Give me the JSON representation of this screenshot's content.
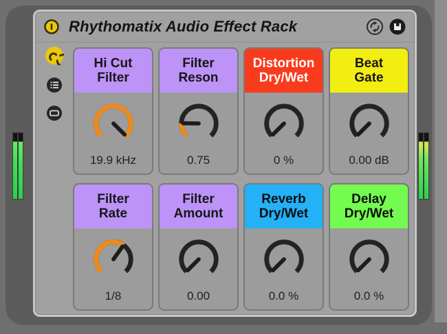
{
  "theme": {
    "page_bg": "#6f6f6f",
    "panel_bg": "#5c5c5c",
    "rack_bg": "#a1a1a1",
    "rack_border": "#c9c9c9",
    "tile_bg": "#9c9c9c",
    "tile_border": "#7a7a7a",
    "knob_ring": "#232323",
    "knob_active": "#ef8a1b",
    "knob_pointer": "#1d1d1d",
    "meter_cap": "#141414",
    "meter_green": "#2bd04e",
    "meter_yellow": "#c9e955",
    "accent_yellow": "#edc70c",
    "header_purple": "#bd93f7",
    "header_red": "#f93b1d",
    "header_yellow": "#f2ee12",
    "header_blue": "#24b1f6",
    "header_green": "#73fb50"
  },
  "title_bar": {
    "title": "Rhythomatix Audio Effect Rack",
    "icons": {
      "power": "device-activator-icon",
      "hot_swap": "hot-swap-icon",
      "save": "save-preset-icon"
    }
  },
  "sidebar": {
    "buttons": [
      {
        "id": "show-macros",
        "icon": "macro-spiral-icon"
      },
      {
        "id": "show-chain-list",
        "icon": "chain-list-icon"
      },
      {
        "id": "show-devices",
        "icon": "devices-icon"
      }
    ]
  },
  "meters": {
    "left_channels": 2,
    "right_channels": 2
  },
  "macros": [
    {
      "id": "hi-cut-filter",
      "label": [
        "Hi Cut",
        "Filter"
      ],
      "value": "19.9 kHz",
      "header_color": "#bd93f7",
      "label_color": "#161616",
      "knob_fraction": 1.0
    },
    {
      "id": "filter-reson",
      "label": [
        "Filter",
        "Reson"
      ],
      "value": "0.75",
      "header_color": "#bd93f7",
      "label_color": "#161616",
      "knob_fraction": 0.17
    },
    {
      "id": "distortion-dry-wet",
      "label": [
        "Distortion",
        "Dry/Wet"
      ],
      "value": "0 %",
      "header_color": "#f93b1d",
      "label_color": "#ffffff",
      "knob_fraction": 0.0
    },
    {
      "id": "beat-gate",
      "label": [
        "Beat",
        "Gate"
      ],
      "value": "0.00 dB",
      "header_color": "#f2ee12",
      "label_color": "#161616",
      "knob_fraction": 0.0
    },
    {
      "id": "filter-rate",
      "label": [
        "Filter",
        "Rate"
      ],
      "value": "1/8",
      "header_color": "#bd93f7",
      "label_color": "#161616",
      "knob_fraction": 0.63
    },
    {
      "id": "filter-amount",
      "label": [
        "Filter",
        "Amount"
      ],
      "value": "0.00",
      "header_color": "#bd93f7",
      "label_color": "#161616",
      "knob_fraction": 0.0
    },
    {
      "id": "reverb-dry-wet",
      "label": [
        "Reverb",
        "Dry/Wet"
      ],
      "value": "0.0 %",
      "header_color": "#24b1f6",
      "label_color": "#0d0d0d",
      "knob_fraction": 0.0
    },
    {
      "id": "delay-dry-wet",
      "label": [
        "Delay",
        "Dry/Wet"
      ],
      "value": "0.0 %",
      "header_color": "#73fb50",
      "label_color": "#0d0d0d",
      "knob_fraction": 0.0
    }
  ]
}
